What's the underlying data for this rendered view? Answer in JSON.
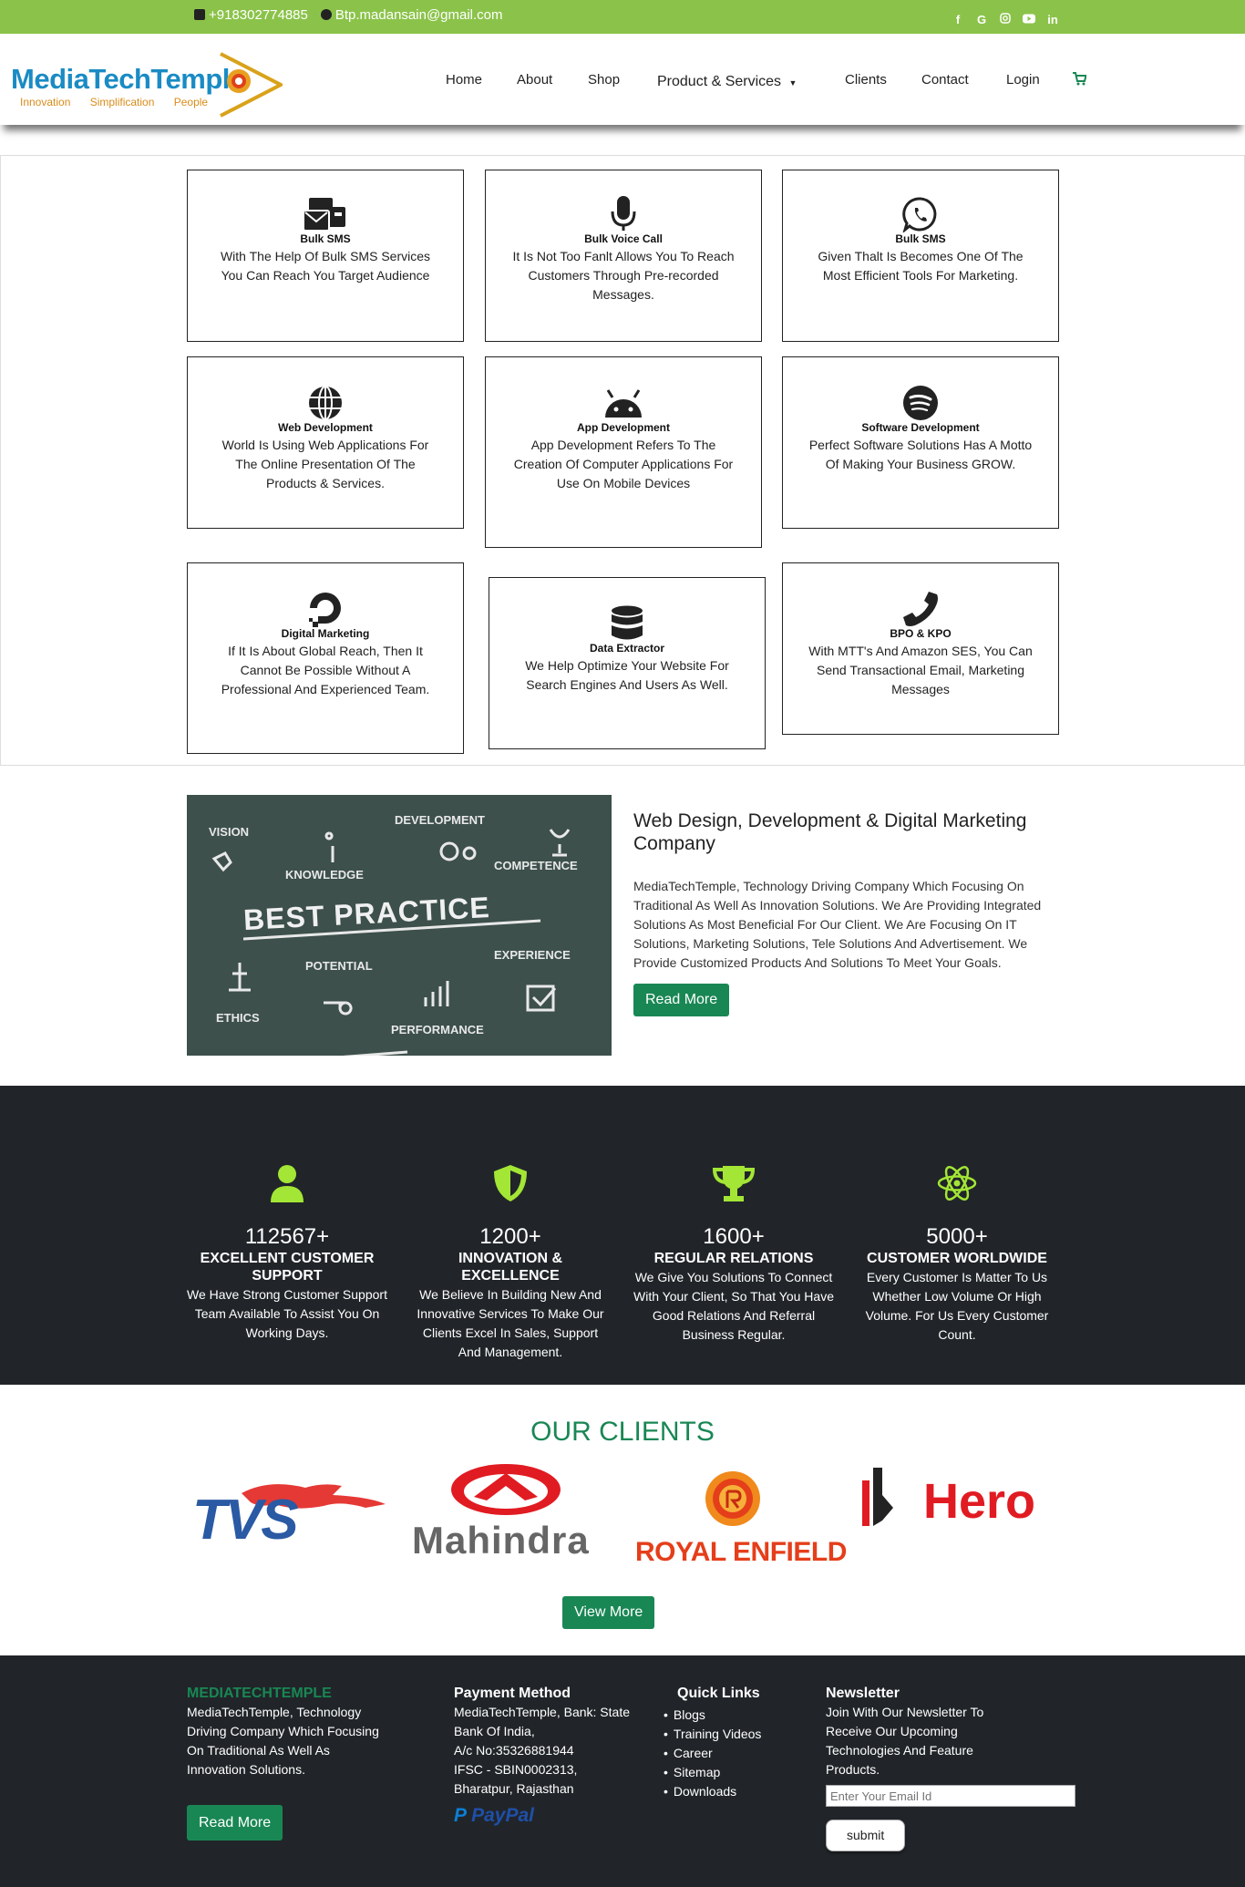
{
  "topbar": {
    "phone": "+918302774885",
    "email": "Btp.madansain@gmail.com",
    "social": [
      "facebook-icon",
      "google-icon",
      "instagram-icon",
      "youtube-icon",
      "linkedin-icon"
    ]
  },
  "header": {
    "logo_name": "MediaTechTemple",
    "logo_tag": "Innovation Simplification People",
    "nav": [
      "Home",
      "About",
      "Shop",
      "Product & Services",
      "Clients",
      "Contact",
      "Login"
    ]
  },
  "services": [
    {
      "title": "Bulk SMS",
      "desc": "With The Help Of Bulk SMS Services You Can Reach You Target Audience",
      "icon": "sms-icon"
    },
    {
      "title": "Bulk Voice Call",
      "desc": "It Is Not Too Fanlt Allows You To Reach Customers Through Pre-recorded Messages.",
      "icon": "microphone-icon"
    },
    {
      "title": "Bulk SMS",
      "desc": "Given Thalt Is Becomes One Of The Most Efficient Tools For Marketing.",
      "icon": "whatsapp-icon"
    },
    {
      "title": "Web Development",
      "desc": "World Is Using Web Applications For The Online Presentation Of The Products & Services.",
      "icon": "globe-icon"
    },
    {
      "title": "App Development",
      "desc": "App Development Refers To The Creation Of Computer Applications For Use On Mobile Devices",
      "icon": "android-icon"
    },
    {
      "title": "Software Development",
      "desc": "Perfect Software Solutions Has A Motto Of Making Your Business GROW.",
      "icon": "spotify-icon"
    },
    {
      "title": "Digital Marketing",
      "desc": "If It Is About Global Reach, Then It Cannot Be Possible Without A Professional And Experienced Team.",
      "icon": "digitalocean-icon"
    },
    {
      "title": "Data Extractor",
      "desc": "We Help Optimize Your Website For Search Engines And Users As Well.",
      "icon": "database-icon"
    },
    {
      "title": "BPO & KPO",
      "desc": "With MTT's And Amazon SES, You Can Send Transactional Email, Marketing Messages",
      "icon": "phone-icon"
    }
  ],
  "about": {
    "heading": "Web Design, Development & Digital Marketing Company",
    "body": "MediaTechTemple, Technology Driving Company Which Focusing On Traditional As Well As Innovation Solutions. We Are Providing Integrated Solutions As Most Beneficial For Our Client. We Are Focusing On IT Solutions, Marketing Solutions, Tele Solutions And Advertisement. We Provide Customized Products And Solutions To Meet Your Goals.",
    "button": "Read More",
    "image_words": {
      "vision": "VISION",
      "development": "DEVELOPMENT",
      "knowledge": "KNOWLEDGE",
      "competence": "COMPETENCE",
      "best_practice": "BEST PRACTICE",
      "potential": "POTENTIAL",
      "experience": "EXPERIENCE",
      "ethics": "ETHICS",
      "performance": "PERFORMANCE"
    }
  },
  "stats": [
    {
      "num": "112567+",
      "head": "EXCELLENT CUSTOMER SUPPORT",
      "desc": "We Have Strong Customer Support Team Available To Assist You On Working Days.",
      "icon": "user-icon"
    },
    {
      "num": "1200+",
      "head": "INNOVATION & EXCELLENCE",
      "desc": "We Believe In Building New And Innovative Services To Make Our Clients Excel In Sales, Support And Management.",
      "icon": "shield-icon"
    },
    {
      "num": "1600+",
      "head": "REGULAR RELATIONS",
      "desc": "We Give You Solutions To Connect With Your Client, So That You Have Good Relations And Referral Business Regular.",
      "icon": "trophy-icon"
    },
    {
      "num": "5000+",
      "head": "CUSTOMER WORLDWIDE",
      "desc": "Every Customer Is Matter To Us Whether Low Volume Or High Volume. For Us Every Customer Count.",
      "icon": "react-icon"
    }
  ],
  "clients": {
    "title": "OUR CLIENTS",
    "logos": [
      "TVS",
      "Mahindra",
      "ROYAL ENFIELD",
      "Hero"
    ],
    "button": "View More"
  },
  "footer": {
    "brand": "MEDIATECHTEMPLE",
    "brand_desc": "MediaTechTemple, Technology Driving Company Which Focusing On Traditional As Well As Innovation Solutions.",
    "read_more": "Read More",
    "payment_title": "Payment Method",
    "payment_lines": [
      "MediaTechTemple, Bank: State Bank Of India,",
      "A/c No:35326881944",
      "IFSC - SBIN0002313,",
      "Bharatpur, Rajasthan"
    ],
    "paypal": "PayPal",
    "links_title": "Quick Links",
    "links": [
      "Blogs",
      "Training Videos",
      "Career",
      "Sitemap",
      "Downloads"
    ],
    "news_title": "Newsletter",
    "news_desc": "Join With Our Newsletter To Receive Our Upcoming Technologies And Feature Products.",
    "email_placeholder": "Enter Your Email Id",
    "submit": "submit"
  },
  "colors": {
    "topbar": "#8bc34a",
    "accent_green": "#198754",
    "dark": "#212529",
    "stat_icon": "#a3e635"
  }
}
